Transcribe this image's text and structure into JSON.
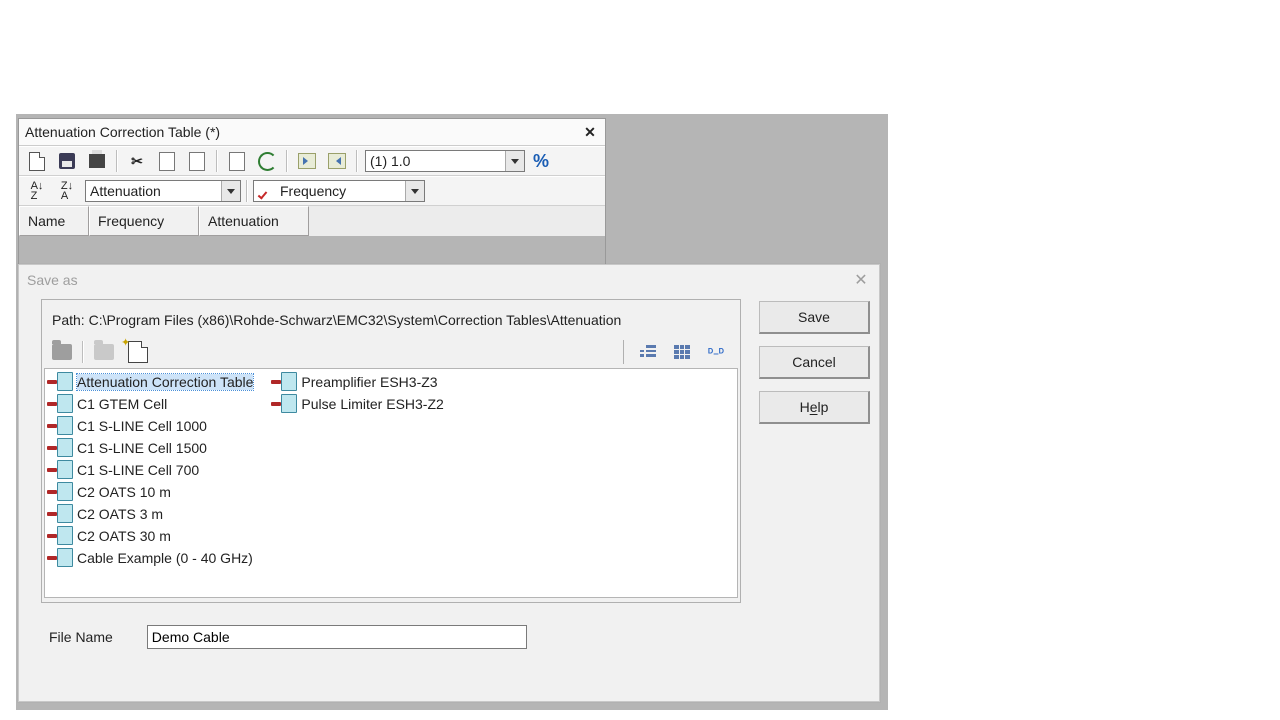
{
  "main_window": {
    "title": "Attenuation Correction Table (*)",
    "combo_value": "(1) 1.0",
    "combo_unit": "Attenuation",
    "combo_axis": "Frequency",
    "columns": {
      "name": "Name",
      "freq": "Frequency",
      "att": "Attenuation"
    }
  },
  "saveas": {
    "title": "Save as",
    "path_label": "Path: C:\\Program Files (x86)\\Rohde-Schwarz\\EMC32\\System\\Correction Tables\\Attenuation",
    "files_col1": [
      "Attenuation Correction Table",
      "C1 GTEM Cell",
      "C1 S-LINE Cell 1000",
      "C1 S-LINE Cell 1500",
      "C1 S-LINE Cell 700",
      "C2 OATS 10 m",
      "C2 OATS 3 m",
      "C2 OATS 30 m",
      "Cable Example (0 - 40 GHz)"
    ],
    "files_col2": [
      "Preamplifier ESH3-Z3",
      "Pulse Limiter ESH3-Z2"
    ],
    "filename_label": "File Name",
    "filename_value": "Demo Cable",
    "buttons": {
      "save": "Save",
      "cancel": "Cancel",
      "help_pre": "H",
      "help_ul": "e",
      "help_post": "lp"
    }
  }
}
